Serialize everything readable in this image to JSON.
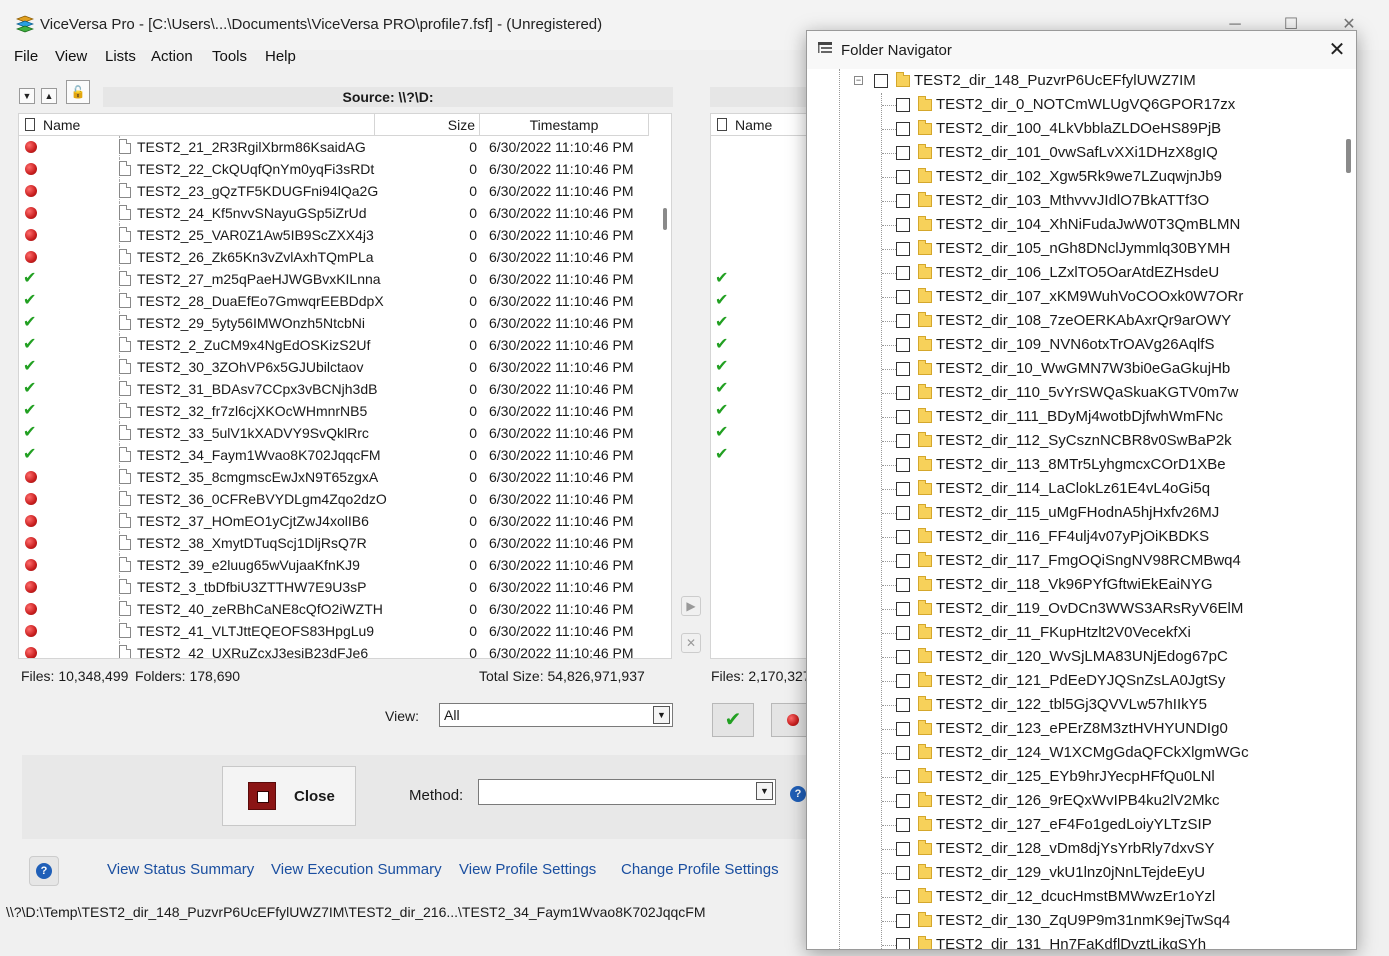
{
  "window": {
    "title": "ViceVersa Pro - [C:\\Users\\...\\Documents\\ViceVersa PRO\\profile7.fsf] - (Unregistered)"
  },
  "menu": [
    "File",
    "View",
    "Lists",
    "Action",
    "Tools",
    "Help"
  ],
  "source": {
    "label": "Source: \\\\?\\D:",
    "columns": {
      "name": "Name",
      "size": "Size",
      "timestamp": "Timestamp"
    },
    "rows": [
      {
        "status": "red",
        "name": "TEST2_21_2R3RgilXbrm86KsaidAG",
        "size": "0",
        "ts": "6/30/2022 11:10:46 PM"
      },
      {
        "status": "red",
        "name": "TEST2_22_CkQUqfQnYm0yqFi3sRDt",
        "size": "0",
        "ts": "6/30/2022 11:10:46 PM"
      },
      {
        "status": "red",
        "name": "TEST2_23_gQzTF5KDUGFni94lQa2G",
        "size": "0",
        "ts": "6/30/2022 11:10:46 PM"
      },
      {
        "status": "red",
        "name": "TEST2_24_Kf5nvvSNayuGSp5iZrUd",
        "size": "0",
        "ts": "6/30/2022 11:10:46 PM"
      },
      {
        "status": "red",
        "name": "TEST2_25_VAR0Z1Aw5IB9ScZXX4j3",
        "size": "0",
        "ts": "6/30/2022 11:10:46 PM"
      },
      {
        "status": "red",
        "name": "TEST2_26_Zk65Kn3vZvlAxhTQmPLa",
        "size": "0",
        "ts": "6/30/2022 11:10:46 PM"
      },
      {
        "status": "check",
        "name": "TEST2_27_m25qPaeHJWGBvxKILnna",
        "size": "0",
        "ts": "6/30/2022 11:10:46 PM"
      },
      {
        "status": "check",
        "name": "TEST2_28_DuaEfEo7GmwqrEEBDdpX",
        "size": "0",
        "ts": "6/30/2022 11:10:46 PM"
      },
      {
        "status": "check",
        "name": "TEST2_29_5yty56IMWOnzh5NtcbNi",
        "size": "0",
        "ts": "6/30/2022 11:10:46 PM"
      },
      {
        "status": "check",
        "name": "TEST2_2_ZuCM9x4NgEdOSKizS2Uf",
        "size": "0",
        "ts": "6/30/2022 11:10:46 PM"
      },
      {
        "status": "check",
        "name": "TEST2_30_3ZOhVP6x5GJUbilctaov",
        "size": "0",
        "ts": "6/30/2022 11:10:46 PM"
      },
      {
        "status": "check",
        "name": "TEST2_31_BDAsv7CCpx3vBCNjh3dB",
        "size": "0",
        "ts": "6/30/2022 11:10:46 PM"
      },
      {
        "status": "check",
        "name": "TEST2_32_fr7zl6cjXKOcWHmnrNB5",
        "size": "0",
        "ts": "6/30/2022 11:10:46 PM"
      },
      {
        "status": "check",
        "name": "TEST2_33_5ulV1kXADVY9SvQklRrc",
        "size": "0",
        "ts": "6/30/2022 11:10:46 PM"
      },
      {
        "status": "check",
        "name": "TEST2_34_Faym1Wvao8K702JqqcFM",
        "size": "0",
        "ts": "6/30/2022 11:10:46 PM"
      },
      {
        "status": "red",
        "name": "TEST2_35_8cmgmscEwJxN9T65zgxA",
        "size": "0",
        "ts": "6/30/2022 11:10:46 PM"
      },
      {
        "status": "red",
        "name": "TEST2_36_0CFReBVYDLgm4Zqo2dzO",
        "size": "0",
        "ts": "6/30/2022 11:10:46 PM"
      },
      {
        "status": "red",
        "name": "TEST2_37_HOmEO1yCjtZwJ4xolIB6",
        "size": "0",
        "ts": "6/30/2022 11:10:46 PM"
      },
      {
        "status": "red",
        "name": "TEST2_38_XmytDTuqScj1DljRsQ7R",
        "size": "0",
        "ts": "6/30/2022 11:10:46 PM"
      },
      {
        "status": "red",
        "name": "TEST2_39_e2luug65wVujaaKfnKJ9",
        "size": "0",
        "ts": "6/30/2022 11:10:46 PM"
      },
      {
        "status": "red",
        "name": "TEST2_3_tbDfbiU3ZTTHW7E9U3sP",
        "size": "0",
        "ts": "6/30/2022 11:10:46 PM"
      },
      {
        "status": "red",
        "name": "TEST2_40_zeRBhCaNE8cQfO2iWZTH",
        "size": "0",
        "ts": "6/30/2022 11:10:46 PM"
      },
      {
        "status": "red",
        "name": "TEST2_41_VLTJttEQEOFS83HpgLu9",
        "size": "0",
        "ts": "6/30/2022 11:10:46 PM"
      },
      {
        "status": "red",
        "name": "TEST2_42_UXRuZcxJ3esiB23dFJe6",
        "size": "0",
        "ts": "6/30/2022 11:10:46 PM"
      }
    ],
    "stats": {
      "files": "Files: 10,348,499",
      "folders": "Folders: 178,690",
      "total_size": "Total Size: 54,826,971,937"
    }
  },
  "target": {
    "columns": {
      "name": "Name"
    },
    "checks": [
      6,
      7,
      8,
      9,
      10,
      11,
      12,
      13,
      14
    ],
    "stats": {
      "files": "Files: 2,170,327"
    }
  },
  "view": {
    "label": "View:",
    "value": "All"
  },
  "close_button": {
    "label": "Close"
  },
  "method": {
    "label": "Method:",
    "value": ""
  },
  "links": [
    "View Status Summary",
    "View Execution Summary",
    "View Profile Settings",
    "Change Profile Settings"
  ],
  "status_path": "\\\\?\\D:\\Temp\\TEST2_dir_148_PuzvrP6UcEFfylUWZ7IM\\TEST2_dir_216...\\TEST2_34_Faym1Wvao8K702JqqcFM",
  "folder_navigator": {
    "title": "Folder Navigator",
    "root": "TEST2_dir_148_PuzvrP6UcEFfylUWZ7IM",
    "children": [
      "TEST2_dir_0_NOTCmWLUgVQ6GPOR17zx",
      "TEST2_dir_100_4LkVbblaZLDOeHS89PjB",
      "TEST2_dir_101_0vwSafLvXXi1DHzX8gIQ",
      "TEST2_dir_102_Xgw5Rk9we7LZuqwjnJb9",
      "TEST2_dir_103_MthvvvJIdlO7BkATTf3O",
      "TEST2_dir_104_XhNiFudaJwW0T3QmBLMN",
      "TEST2_dir_105_nGh8DNclJymmlq30BYMH",
      "TEST2_dir_106_LZxlTO5OarAtdEZHsdeU",
      "TEST2_dir_107_xKM9WuhVoCOOxk0W7ORr",
      "TEST2_dir_108_7zeOERKAbAxrQr9arOWY",
      "TEST2_dir_109_NVN6otxTrOAVg26AqlfS",
      "TEST2_dir_10_WwGMN7W3bi0eGaGkujHb",
      "TEST2_dir_110_5vYrSWQaSkuaKGTV0m7w",
      "TEST2_dir_111_BDyMj4wotbDjfwhWmFNc",
      "TEST2_dir_112_SyCsznNCBR8v0SwBaP2k",
      "TEST2_dir_113_8MTr5LyhgmcxCOrD1XBe",
      "TEST2_dir_114_LaClokLz61E4vL4oGi5q",
      "TEST2_dir_115_uMgFHodnA5hjHxfv26MJ",
      "TEST2_dir_116_FF4ulj4v07yPjOiKBDKS",
      "TEST2_dir_117_FmgOQiSngNV98RCMBwq4",
      "TEST2_dir_118_Vk96PYfGftwiEkEaiNYG",
      "TEST2_dir_119_OvDCn3WWS3ARsRyV6ElM",
      "TEST2_dir_11_FKupHtzlt2V0VecekfXi",
      "TEST2_dir_120_WvSjLMA83UNjEdog67pC",
      "TEST2_dir_121_PdEeDYJQSnZsLA0JgtSy",
      "TEST2_dir_122_tbl5Gj3QVVLw57hIIkY5",
      "TEST2_dir_123_ePErZ8M3ztHVHYUNDIg0",
      "TEST2_dir_124_W1XCMgGdaQFCkXlgmWGc",
      "TEST2_dir_125_EYb9hrJYecpHFfQu0LNl",
      "TEST2_dir_126_9rEQxWvIPB4ku2lV2Mkc",
      "TEST2_dir_127_eF4Fo1gedLoiyYLTzSIP",
      "TEST2_dir_128_vDm8djYsYrbRly7dxvSY",
      "TEST2_dir_129_vkU1lnz0jNnLTejdeEyU",
      "TEST2_dir_12_dcucHmstBMWwzEr1oYzl",
      "TEST2_dir_130_ZqU9P9m31nmK9ejTwSq4",
      "TEST2_dir_131_Hn7FaKdflDvztLikqSYh"
    ]
  },
  "colors": {
    "accent_link": "#1b4fa0",
    "status_red": "#c81e1e",
    "status_green": "#22a022",
    "folder": "#f7d15a",
    "close_icon": "#8b1515"
  }
}
